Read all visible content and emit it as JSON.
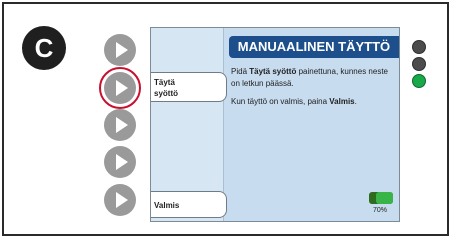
{
  "step_label": "C",
  "screen": {
    "title": "MANUAALINEN TÄYTTÖ",
    "left_labels": {
      "fill_line1": "Täytä",
      "fill_line2": "syöttö",
      "done": "Valmis"
    },
    "instruction": {
      "p1_pre": "Pidä ",
      "p1_bold": "Täytä syöttö",
      "p1_post": " painettuna, kunnes neste on letkun päässä.",
      "p2_pre": "Kun täyttö on valmis, paina ",
      "p2_bold": "Valmis",
      "p2_post": "."
    },
    "battery": {
      "percent_text": "70%",
      "level": 0.7
    }
  },
  "softkeys": [
    {
      "name": "softkey-1",
      "active": false
    },
    {
      "name": "softkey-2",
      "active": true
    },
    {
      "name": "softkey-3",
      "active": false
    },
    {
      "name": "softkey-4",
      "active": false
    },
    {
      "name": "softkey-5",
      "active": false
    }
  ],
  "indicator_lights": [
    {
      "state": "off",
      "color": "#4c4c4c"
    },
    {
      "state": "off",
      "color": "#4c4c4c"
    },
    {
      "state": "on",
      "color": "#19a84a"
    }
  ],
  "colors": {
    "header_bar": "#1c4f8c",
    "screen_bg": "#c7dcef",
    "active_ring": "#c8102e",
    "battery_fill": "#38b449"
  }
}
